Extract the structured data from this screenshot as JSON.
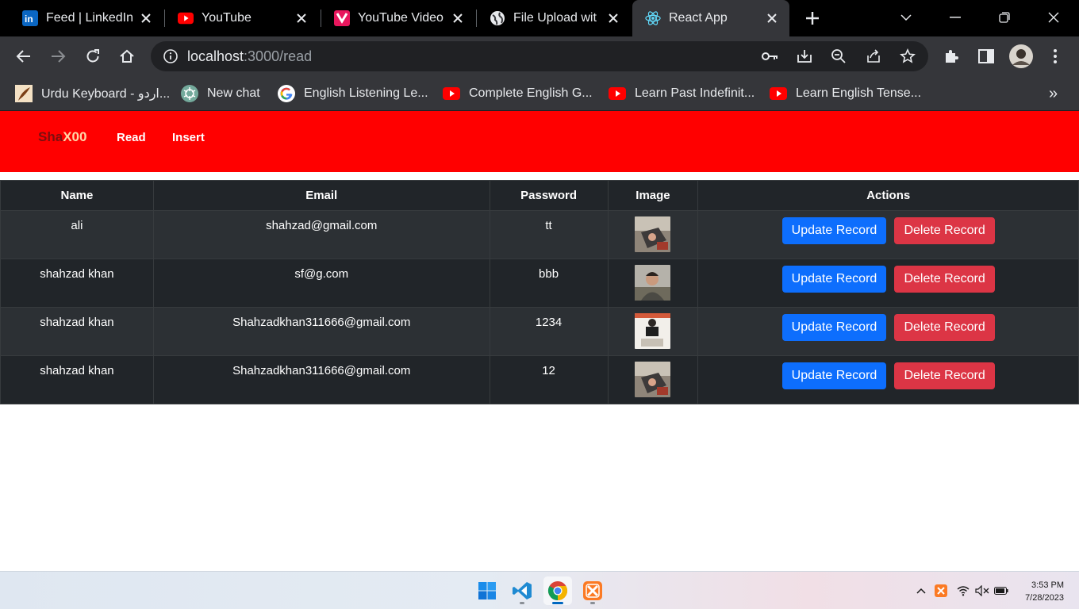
{
  "browser": {
    "tabs": [
      {
        "title": "Feed | LinkedIn",
        "icon": "linkedin-icon",
        "active": false
      },
      {
        "title": "YouTube",
        "icon": "youtube-icon",
        "active": false
      },
      {
        "title": "YouTube Video",
        "icon": "download-app-icon",
        "active": false
      },
      {
        "title": "File Upload wit",
        "icon": "globe-icon",
        "active": false
      },
      {
        "title": "React App",
        "icon": "react-icon",
        "active": true
      }
    ],
    "url_host": "localhost",
    "url_path": ":3000/read",
    "bookmarks": [
      {
        "label": "Urdu Keyboard - اردو...",
        "icon": "feather-icon"
      },
      {
        "label": "New chat",
        "icon": "chatgpt-icon"
      },
      {
        "label": "English Listening Le...",
        "icon": "google-icon"
      },
      {
        "label": "Complete English G...",
        "icon": "youtube-icon"
      },
      {
        "label": "Learn Past Indefinit...",
        "icon": "youtube-icon"
      },
      {
        "label": "Learn English Tense...",
        "icon": "youtube-icon"
      }
    ],
    "bookmarks_overflow": "»"
  },
  "app": {
    "brand_part1": "Sha",
    "brand_part2": "X00",
    "nav": [
      "Read",
      "Insert"
    ],
    "table": {
      "headers": [
        "Name",
        "Email",
        "Password",
        "Image",
        "Actions"
      ],
      "rows": [
        {
          "name": "ali",
          "email": "shahzad@gmail.com",
          "password": "tt"
        },
        {
          "name": "shahzad khan",
          "email": "sf@g.com",
          "password": "bbb"
        },
        {
          "name": "shahzad khan",
          "email": "Shahzadkhan311666@gmail.com",
          "password": "1234"
        },
        {
          "name": "shahzad khan",
          "email": "Shahzadkhan311666@gmail.com",
          "password": "12"
        }
      ],
      "update_label": "Update Record",
      "delete_label": "Delete Record"
    },
    "colors": {
      "navbar": "#ff0000",
      "update_button": "#0d6efd",
      "delete_button": "#dc3545",
      "table_bg": "#212529"
    }
  },
  "taskbar": {
    "apps": [
      "windows-start-icon",
      "vscode-icon",
      "chrome-icon",
      "xampp-icon"
    ],
    "time": "3:53 PM",
    "date": "7/28/2023"
  }
}
